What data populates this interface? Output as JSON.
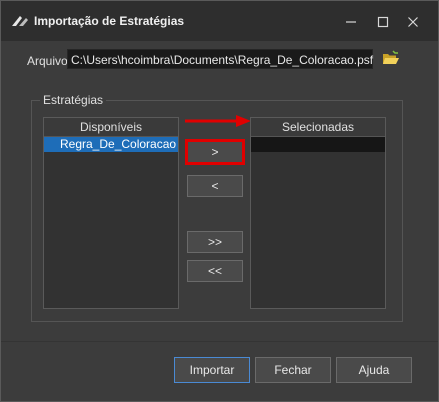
{
  "window": {
    "title": "Importação de Estratégias",
    "minimize_symbol": "—",
    "maximize_symbol": "☐",
    "close_symbol": "✕"
  },
  "file": {
    "label": "Arquivo",
    "path": "C:\\Users\\hcoimbra\\Documents\\Regra_De_Coloracao.psf",
    "browse_icon": "open-folder-icon"
  },
  "strategies": {
    "group_label": "Estratégias",
    "available": {
      "header": "Disponíveis",
      "items": [
        "Regra_De_Coloracao"
      ]
    },
    "selected": {
      "header": "Selecionadas",
      "items": []
    },
    "buttons": {
      "add": ">",
      "remove": "<",
      "add_all": ">>",
      "remove_all": "<<"
    }
  },
  "actions": {
    "import": "Importar",
    "close": "Fechar",
    "help": "Ajuda"
  },
  "colors": {
    "highlight_red": "#e00000",
    "selection_blue": "#1e6db8",
    "background": "#3c3c3c"
  }
}
